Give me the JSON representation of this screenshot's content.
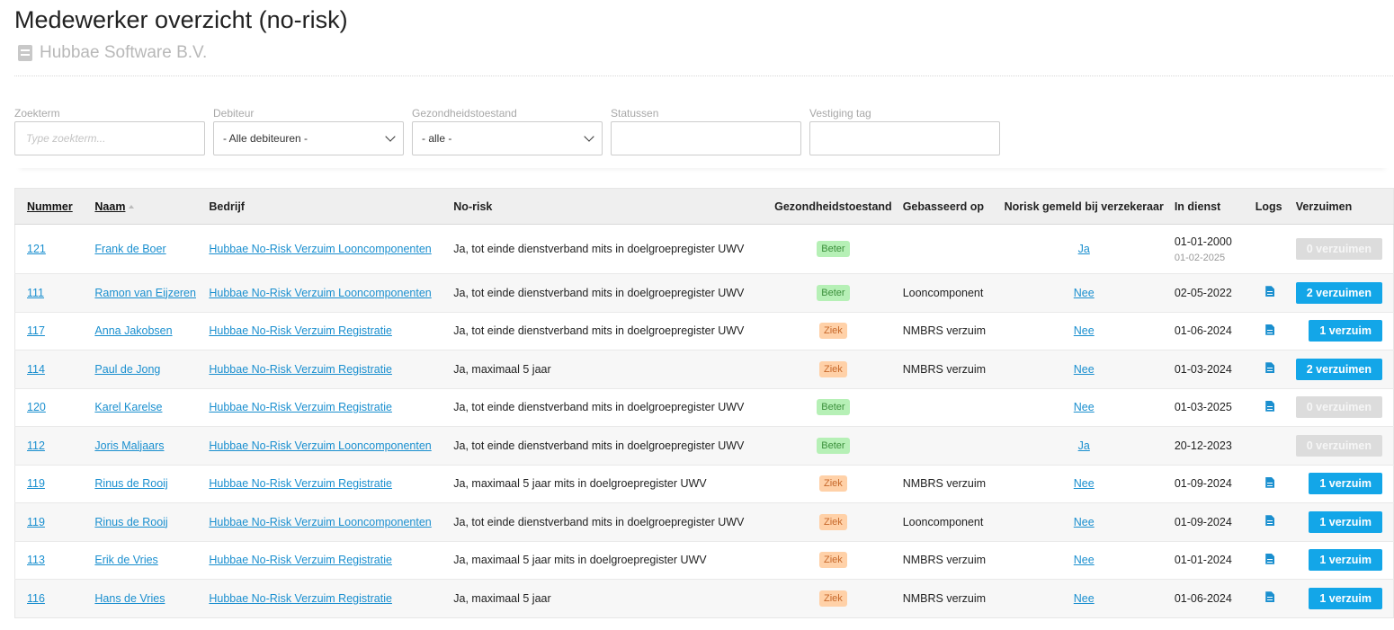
{
  "page": {
    "title": "Medewerker overzicht (no-risk)",
    "company": "Hubbae Software B.V."
  },
  "filters": {
    "zoekterm": {
      "label": "Zoekterm",
      "placeholder": "Type zoekterm..."
    },
    "debiteur": {
      "label": "Debiteur",
      "value": "- Alle debiteuren -"
    },
    "gezondheid": {
      "label": "Gezondheidstoestand",
      "value": "- alle -"
    },
    "statussen": {
      "label": "Statussen",
      "value": ""
    },
    "vestiging": {
      "label": "Vestiging tag",
      "value": ""
    }
  },
  "table": {
    "headers": {
      "nummer": "Nummer",
      "naam": "Naam",
      "bedrijf": "Bedrijf",
      "norisk": "No-risk",
      "gezondheid": "Gezondheidstoestand",
      "gebaseerd": "Gebasseerd op",
      "gemeld": "Norisk gemeld bij verzekeraar",
      "indienst": "In dienst",
      "logs": "Logs",
      "verzuimen": "Verzuimen"
    },
    "rows": [
      {
        "nummer": "121",
        "naam": "Frank de Boer",
        "bedrijf": "Hubbae No-Risk Verzuim Looncomponenten",
        "norisk": "Ja, tot einde dienstverband mits in doelgroepregister UWV",
        "status": "Beter",
        "gebaseerd": "",
        "gemeld": "Ja",
        "indienst": "01-01-2000",
        "uitdienst": "01-02-2025",
        "log": false,
        "verzuimen": "0 verzuimen"
      },
      {
        "nummer": "111",
        "naam": "Ramon van Eijzeren",
        "bedrijf": "Hubbae No-Risk Verzuim Looncomponenten",
        "norisk": "Ja, tot einde dienstverband mits in doelgroepregister UWV",
        "status": "Beter",
        "gebaseerd": "Looncomponent",
        "gemeld": "Nee",
        "indienst": "02-05-2022",
        "uitdienst": "",
        "log": true,
        "verzuimen": "2 verzuimen"
      },
      {
        "nummer": "117",
        "naam": "Anna Jakobsen",
        "bedrijf": "Hubbae No-Risk Verzuim Registratie",
        "norisk": "Ja, tot einde dienstverband mits in doelgroepregister UWV",
        "status": "Ziek",
        "gebaseerd": "NMBRS verzuim",
        "gemeld": "Nee",
        "indienst": "01-06-2024",
        "uitdienst": "",
        "log": true,
        "verzuimen": "1 verzuim"
      },
      {
        "nummer": "114",
        "naam": "Paul de Jong",
        "bedrijf": "Hubbae No-Risk Verzuim Registratie",
        "norisk": "Ja, maximaal 5 jaar",
        "status": "Ziek",
        "gebaseerd": "NMBRS verzuim",
        "gemeld": "Nee",
        "indienst": "01-03-2024",
        "uitdienst": "",
        "log": true,
        "verzuimen": "2 verzuimen"
      },
      {
        "nummer": "120",
        "naam": "Karel Karelse",
        "bedrijf": "Hubbae No-Risk Verzuim Registratie",
        "norisk": "Ja, tot einde dienstverband mits in doelgroepregister UWV",
        "status": "Beter",
        "gebaseerd": "",
        "gemeld": "Nee",
        "indienst": "01-03-2025",
        "uitdienst": "",
        "log": true,
        "verzuimen": "0 verzuimen"
      },
      {
        "nummer": "112",
        "naam": "Joris Maljaars",
        "bedrijf": "Hubbae No-Risk Verzuim Looncomponenten",
        "norisk": "Ja, tot einde dienstverband mits in doelgroepregister UWV",
        "status": "Beter",
        "gebaseerd": "",
        "gemeld": "Ja",
        "indienst": "20-12-2023",
        "uitdienst": "",
        "log": false,
        "verzuimen": "0 verzuimen"
      },
      {
        "nummer": "119",
        "naam": "Rinus de Rooij",
        "bedrijf": "Hubbae No-Risk Verzuim Registratie",
        "norisk": "Ja, maximaal 5 jaar mits in doelgroepregister UWV",
        "status": "Ziek",
        "gebaseerd": "NMBRS verzuim",
        "gemeld": "Nee",
        "indienst": "01-09-2024",
        "uitdienst": "",
        "log": true,
        "verzuimen": "1 verzuim"
      },
      {
        "nummer": "119",
        "naam": "Rinus de Rooij",
        "bedrijf": "Hubbae No-Risk Verzuim Looncomponenten",
        "norisk": "Ja, tot einde dienstverband mits in doelgroepregister UWV",
        "status": "Ziek",
        "gebaseerd": "Looncomponent",
        "gemeld": "Nee",
        "indienst": "01-09-2024",
        "uitdienst": "",
        "log": true,
        "verzuimen": "1 verzuim"
      },
      {
        "nummer": "113",
        "naam": "Erik de Vries",
        "bedrijf": "Hubbae No-Risk Verzuim Registratie",
        "norisk": "Ja, maximaal 5 jaar mits in doelgroepregister UWV",
        "status": "Ziek",
        "gebaseerd": "NMBRS verzuim",
        "gemeld": "Nee",
        "indienst": "01-01-2024",
        "uitdienst": "",
        "log": true,
        "verzuimen": "1 verzuim"
      },
      {
        "nummer": "116",
        "naam": "Hans de Vries",
        "bedrijf": "Hubbae No-Risk Verzuim Registratie",
        "norisk": "Ja, maximaal 5 jaar",
        "status": "Ziek",
        "gebaseerd": "NMBRS verzuim",
        "gemeld": "Nee",
        "indienst": "01-06-2024",
        "uitdienst": "",
        "log": true,
        "verzuimen": "1 verzuim"
      }
    ]
  },
  "colors": {
    "link": "#1a8fcf",
    "button": "#13a6e8",
    "beter_bg": "#b6f0b6",
    "ziek_bg": "#ffd1a8"
  }
}
